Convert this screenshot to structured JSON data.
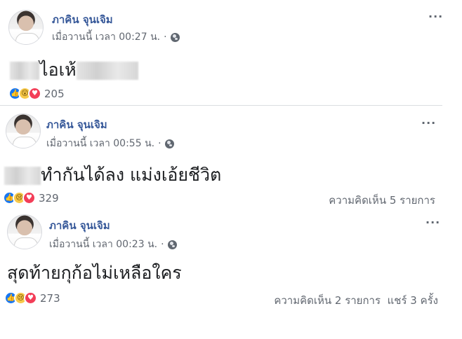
{
  "posts": [
    {
      "author": "ภาคิน จุนเจิม",
      "timestamp": "เมื่อวานนี้ เวลา 00:27 น.",
      "dot": "·",
      "privacy_icon": "globe-icon",
      "more_label": "...",
      "text": "ไอเห้",
      "reactions": [
        "like",
        "wow",
        "love"
      ],
      "reaction_count": "205",
      "comments": "",
      "shares": ""
    },
    {
      "author": "ภาคิน จุนเจิม",
      "timestamp": "เมื่อวานนี้ เวลา 00:55 น.",
      "dot": "·",
      "privacy_icon": "globe-icon",
      "more_label": "...",
      "text": "ทำกันได้ลง แม่งเอ้ยชีวิต",
      "reactions": [
        "like",
        "sad",
        "love"
      ],
      "reaction_count": "329",
      "comments": "ความคิดเห็น 5 รายการ",
      "shares": ""
    },
    {
      "author": "ภาคิน จุนเจิม",
      "timestamp": "เมื่อวานนี้ เวลา 00:23 น.",
      "dot": "·",
      "privacy_icon": "globe-icon",
      "more_label": "...",
      "text": "สุดท้ายกุก้อไม่เหลือใคร",
      "reactions": [
        "like",
        "sad",
        "love"
      ],
      "reaction_count": "273",
      "comments": "ความคิดเห็น 2 รายการ",
      "shares": "แชร์ 3 ครั้ง"
    }
  ],
  "colors": {
    "author": "#365899",
    "meta": "#616770",
    "like": "#1877f2",
    "love": "#f33e58",
    "emoji": "#f7c94a"
  }
}
